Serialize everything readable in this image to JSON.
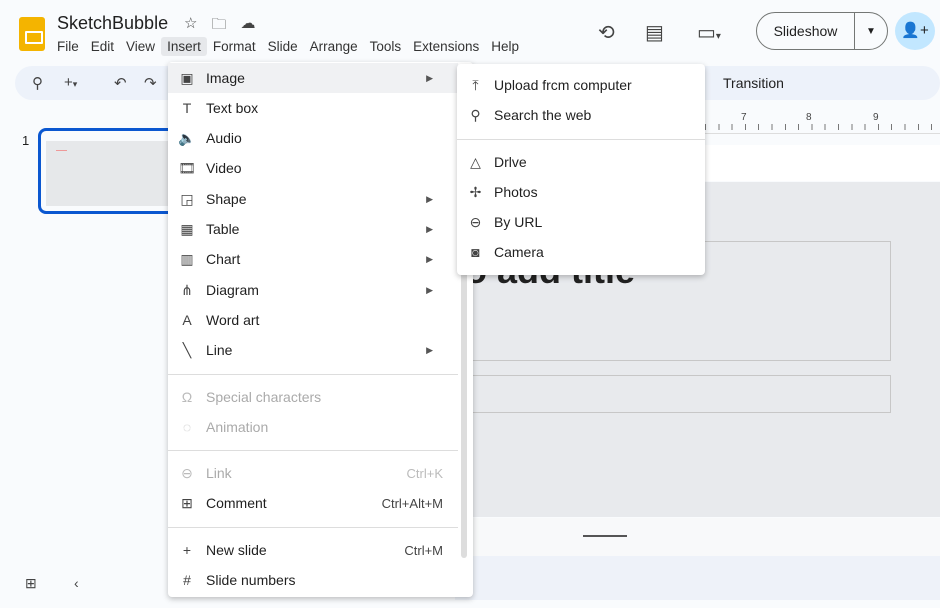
{
  "app": {
    "title": "SketchBubble",
    "title_icons": [
      "star-icon",
      "move-folder-icon",
      "cloud-status-icon"
    ]
  },
  "menubar": [
    "File",
    "Edit",
    "View",
    "Insert",
    "Format",
    "Slide",
    "Arrange",
    "Tools",
    "Extensions",
    "Help"
  ],
  "header": {
    "slideshow": "Slideshow",
    "icons": [
      "history-icon",
      "comment-icon",
      "meet-icon",
      "share-icon"
    ]
  },
  "toolbar": {
    "transition": "Transition"
  },
  "ruler": [
    "7",
    "8",
    "9"
  ],
  "slide": {
    "number": "1",
    "title_partial": "o add title"
  },
  "insert_menu": {
    "items": [
      {
        "label": "Image",
        "icon": "image-icon",
        "submenu": true,
        "highlighted": true
      },
      {
        "label": "Text box",
        "icon": "text-box-icon"
      },
      {
        "label": "Audio",
        "icon": "audio-icon"
      },
      {
        "label": "Video",
        "icon": "video-icon"
      },
      {
        "label": "Shape",
        "icon": "shape-icon",
        "submenu": true
      },
      {
        "label": "Table",
        "icon": "table-icon",
        "submenu": true
      },
      {
        "label": "Chart",
        "icon": "chart-icon",
        "submenu": true
      },
      {
        "label": "Diagram",
        "icon": "diagram-icon",
        "submenu": true
      },
      {
        "label": "Word art",
        "icon": "word-art-icon"
      },
      {
        "label": "Line",
        "icon": "line-icon",
        "submenu": true
      },
      {
        "label": "Special characters",
        "icon": "omega-icon",
        "disabled": true
      },
      {
        "label": "Animation",
        "icon": "animation-icon",
        "disabled": true
      },
      {
        "label": "Link",
        "icon": "link-icon",
        "disabled": true,
        "shortcut": "Ctrl+K"
      },
      {
        "label": "Comment",
        "icon": "add-comment-icon",
        "shortcut": "Ctrl+Alt+M"
      },
      {
        "label": "New slide",
        "icon": "plus-icon",
        "shortcut": "Ctrl+M"
      },
      {
        "label": "Slide numbers",
        "icon": "hash-icon"
      }
    ]
  },
  "image_submenu": [
    {
      "label": "Upload frcm computer",
      "icon": "upload-icon"
    },
    {
      "label": "Search the web",
      "icon": "search-icon"
    },
    {
      "label": "Drlve",
      "icon": "drive-icon"
    },
    {
      "label": "Photos",
      "icon": "photos-icon"
    },
    {
      "label": "By URL",
      "icon": "link-icon"
    },
    {
      "label": "Camera",
      "icon": "camera-icon"
    }
  ],
  "colors": {
    "accent": "#0b57d0",
    "share_bg": "#c2e7ff",
    "logo": "#f4b400"
  }
}
